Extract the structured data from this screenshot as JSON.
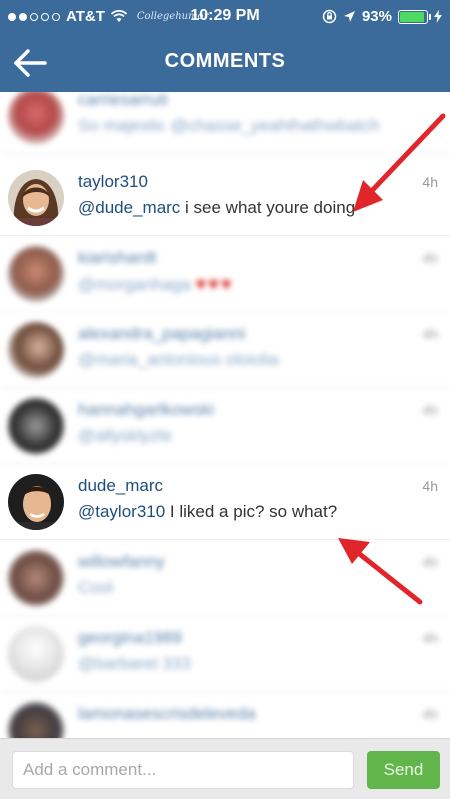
{
  "status_bar": {
    "carrier": "AT&T",
    "watermark": "Collegehumor",
    "time": "10:29 PM",
    "battery": "93%",
    "battery_level": 0.93
  },
  "header": {
    "title": "COMMENTS"
  },
  "comments": [
    {
      "user": "carriesarruti",
      "text": "So majestic @chasse_yeahthathwbatch",
      "time": "",
      "blurred": true
    },
    {
      "user": "taylor310",
      "mention": "@dude_marc",
      "text": " i see what youre doing",
      "time": "4h",
      "blurred": false
    },
    {
      "user": "kiarishardt",
      "text": "@morganhaga",
      "hearts": "♥♥♥",
      "time": "4h",
      "blurred": true
    },
    {
      "user": "alexandra_papagianni",
      "text": "@maria_antonious oloiolia",
      "time": "4h",
      "blurred": true
    },
    {
      "user": "hannahgarlkowski",
      "text": "@allysklyzle",
      "time": "4h",
      "blurred": true
    },
    {
      "user": "dude_marc",
      "mention": "@taylor310",
      "text": " I liked a pic? so what?",
      "time": "4h",
      "blurred": false
    },
    {
      "user": "willowfanny",
      "text": "Cool",
      "time": "4h",
      "blurred": true
    },
    {
      "user": "georgina1989",
      "text": "@barbarel 333",
      "time": "4h",
      "blurred": true
    },
    {
      "user": "lamonasescrisdeleveda",
      "text": "",
      "time": "4h",
      "blurred": true
    }
  ],
  "comment_bar": {
    "placeholder": "Add a comment...",
    "send_label": "Send"
  },
  "colors": {
    "header_bg": "#3a6b9b",
    "username": "#1d4f7c",
    "send_button": "#62b54a",
    "arrow": "#e0262a"
  }
}
